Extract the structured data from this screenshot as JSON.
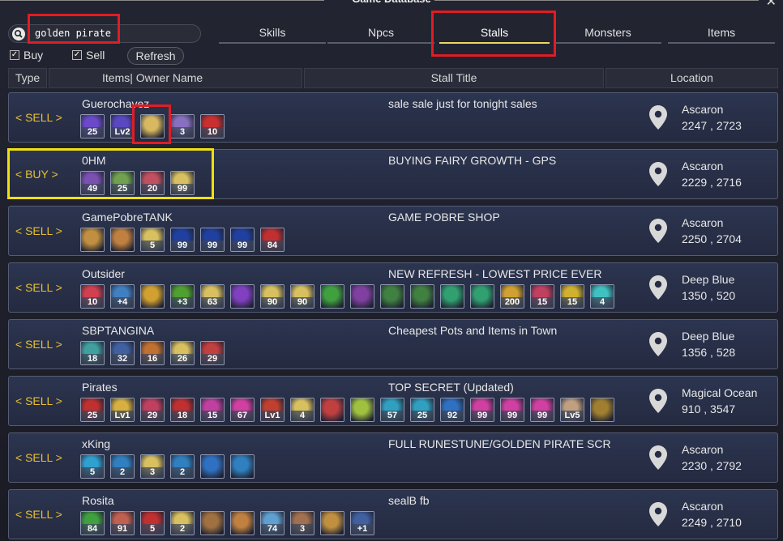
{
  "window": {
    "title": "Game Database"
  },
  "search": {
    "value": "golden pirate"
  },
  "filters": {
    "buy_label": "Buy",
    "sell_label": "Sell",
    "refresh_label": "Refresh"
  },
  "tabs": [
    {
      "label": "Skills"
    },
    {
      "label": "Npcs"
    },
    {
      "label": "Stalls"
    },
    {
      "label": "Monsters"
    },
    {
      "label": "Items"
    }
  ],
  "columns": {
    "type": "Type",
    "owner": "Items| Owner Name",
    "title": "Stall Title",
    "location": "Location"
  },
  "stalls": [
    {
      "type": "< SELL >",
      "owner": "Guerochavez",
      "title": "sale sale just for tonight sales",
      "location": "Ascaron",
      "coords": "2247 , 2723",
      "items": [
        {
          "q": "25",
          "c": "#6a4ac8"
        },
        {
          "q": "Lv2",
          "c": "#5a48c0"
        },
        {
          "q": "",
          "c": "#d8b860"
        },
        {
          "q": "3",
          "c": "#8870c0"
        },
        {
          "q": "10",
          "c": "#c83030"
        }
      ]
    },
    {
      "type": "< BUY >",
      "owner": "0HM",
      "title": "BUYING FAIRY GROWTH - GPS",
      "location": "Ascaron",
      "coords": "2229 , 2716",
      "items": [
        {
          "q": "49",
          "c": "#7a50b0"
        },
        {
          "q": "25",
          "c": "#70a050"
        },
        {
          "q": "20",
          "c": "#c05060"
        },
        {
          "q": "99",
          "c": "#d8c060"
        }
      ]
    },
    {
      "type": "< SELL >",
      "owner": "GamePobreTANK",
      "title": "GAME POBRE SHOP",
      "location": "Ascaron",
      "coords": "2250 , 2704",
      "items": [
        {
          "q": "",
          "c": "#c09040"
        },
        {
          "q": "",
          "c": "#c08040"
        },
        {
          "q": "5",
          "c": "#d8c060"
        },
        {
          "q": "99",
          "c": "#2040a0"
        },
        {
          "q": "99",
          "c": "#2040a0"
        },
        {
          "q": "99",
          "c": "#2040a0"
        },
        {
          "q": "84",
          "c": "#c03030"
        }
      ]
    },
    {
      "type": "< SELL >",
      "owner": "Outsider",
      "title": "NEW REFRESH - LOWEST PRICE EVER",
      "location": "Deep Blue",
      "coords": "1350 , 520",
      "items": [
        {
          "q": "10",
          "c": "#d04050"
        },
        {
          "q": "+4",
          "c": "#4080c0"
        },
        {
          "q": "",
          "c": "#d0a030"
        },
        {
          "q": "+3",
          "c": "#50a030"
        },
        {
          "q": "63",
          "c": "#d8c060"
        },
        {
          "q": "",
          "c": "#8040c0"
        },
        {
          "q": "90",
          "c": "#d8c060"
        },
        {
          "q": "90",
          "c": "#d8c060"
        },
        {
          "q": "",
          "c": "#40a040"
        },
        {
          "q": "",
          "c": "#8040a0"
        },
        {
          "q": "",
          "c": "#408040"
        },
        {
          "q": "",
          "c": "#408040"
        },
        {
          "q": "",
          "c": "#30a070"
        },
        {
          "q": "",
          "c": "#30a070"
        },
        {
          "q": "200",
          "c": "#d0a030"
        },
        {
          "q": "15",
          "c": "#c04060"
        },
        {
          "q": "15",
          "c": "#d0b030"
        },
        {
          "q": "4",
          "c": "#40c0c0"
        }
      ]
    },
    {
      "type": "< SELL >",
      "owner": "SBPTANGINA",
      "title": "Cheapest Pots and Items in Town",
      "location": "Deep Blue",
      "coords": "1356 , 528",
      "items": [
        {
          "q": "18",
          "c": "#40a0a0"
        },
        {
          "q": "32",
          "c": "#4060a0"
        },
        {
          "q": "16",
          "c": "#c07030"
        },
        {
          "q": "26",
          "c": "#d8c060"
        },
        {
          "q": "29",
          "c": "#c04040"
        }
      ]
    },
    {
      "type": "< SELL >",
      "owner": "Pirates",
      "title": "TOP SECRET (Updated)",
      "location": "Magical Ocean",
      "coords": "910 , 3547",
      "items": [
        {
          "q": "25",
          "c": "#c03030"
        },
        {
          "q": "Lv1",
          "c": "#d8b040"
        },
        {
          "q": "29",
          "c": "#c04060"
        },
        {
          "q": "18",
          "c": "#c03030"
        },
        {
          "q": "15",
          "c": "#c040a0"
        },
        {
          "q": "67",
          "c": "#d040a0"
        },
        {
          "q": "Lv1",
          "c": "#c04030"
        },
        {
          "q": "4",
          "c": "#d8c060"
        },
        {
          "q": "",
          "c": "#c04040"
        },
        {
          "q": "",
          "c": "#a0c040"
        },
        {
          "q": "57",
          "c": "#30a0c0"
        },
        {
          "q": "25",
          "c": "#30a0c0"
        },
        {
          "q": "92",
          "c": "#3070c0"
        },
        {
          "q": "99",
          "c": "#d040a0"
        },
        {
          "q": "99",
          "c": "#d040a0"
        },
        {
          "q": "99",
          "c": "#d040a0"
        },
        {
          "q": "Lv5",
          "c": "#c0a080"
        },
        {
          "q": "",
          "c": "#a08030"
        }
      ]
    },
    {
      "type": "< SELL >",
      "owner": "xKing",
      "title": "FULL RUNESTUNE/GOLDEN PIRATE SCR",
      "location": "Ascaron",
      "coords": "2230 , 2792",
      "items": [
        {
          "q": "5",
          "c": "#30a0d0"
        },
        {
          "q": "2",
          "c": "#3080c0"
        },
        {
          "q": "3",
          "c": "#d8c060"
        },
        {
          "q": "2",
          "c": "#3080c0"
        },
        {
          "q": "",
          "c": "#3070c0"
        },
        {
          "q": "",
          "c": "#3080c0"
        }
      ]
    },
    {
      "type": "< SELL >",
      "owner": "Rosita",
      "title": "sealB  fb",
      "location": "Ascaron",
      "coords": "2249 , 2710",
      "items": [
        {
          "q": "84",
          "c": "#40a040"
        },
        {
          "q": "91",
          "c": "#c06050"
        },
        {
          "q": "5",
          "c": "#c03030"
        },
        {
          "q": "2",
          "c": "#d8c060"
        },
        {
          "q": "",
          "c": "#a07040"
        },
        {
          "q": "",
          "c": "#c08040"
        },
        {
          "q": "74",
          "c": "#60a0d0"
        },
        {
          "q": "3",
          "c": "#a07050"
        },
        {
          "q": "",
          "c": "#c09040"
        },
        {
          "q": "+1",
          "c": "#4060a0"
        }
      ]
    }
  ]
}
